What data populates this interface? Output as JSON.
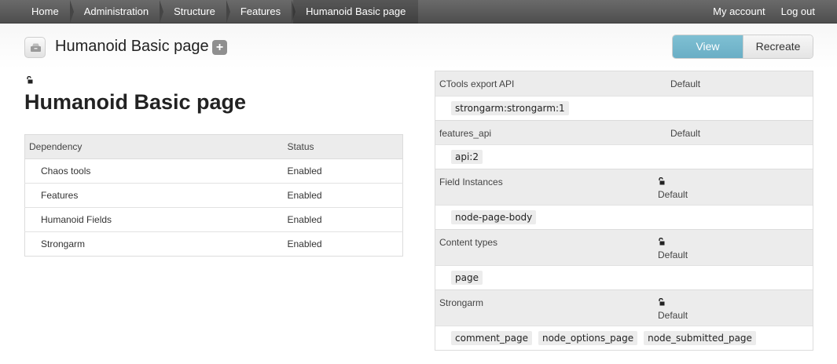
{
  "toolbar": {
    "breadcrumbs": [
      "Home",
      "Administration",
      "Structure",
      "Features",
      "Humanoid Basic page"
    ],
    "user_links": [
      "My account",
      "Log out"
    ]
  },
  "header": {
    "title": "Humanoid Basic page",
    "plus_label": "+",
    "view_label": "View",
    "recreate_label": "Recreate"
  },
  "main": {
    "heading": "Humanoid Basic page",
    "dependency_table": {
      "headers": [
        "Dependency",
        "Status"
      ],
      "rows": [
        {
          "name": "Chaos tools",
          "status": "Enabled"
        },
        {
          "name": "Features",
          "status": "Enabled"
        },
        {
          "name": "Humanoid Fields",
          "status": "Enabled"
        },
        {
          "name": "Strongarm",
          "status": "Enabled"
        }
      ]
    }
  },
  "components": [
    {
      "name": "CTools export API",
      "state": "Default",
      "items": [
        "strongarm:strongarm:1"
      ]
    },
    {
      "name": "features_api",
      "state": "Default",
      "items": [
        "api:2"
      ]
    },
    {
      "name": "Field Instances",
      "state": "Default",
      "items": [
        "node-page-body"
      ]
    },
    {
      "name": "Content types",
      "state": "Default",
      "items": [
        "page"
      ]
    },
    {
      "name": "Strongarm",
      "state": "Default",
      "items": [
        "comment_page",
        "node_options_page",
        "node_submitted_page"
      ]
    }
  ],
  "colors": {
    "toolbar_bg": "#5a5a5a",
    "view_button": "#6fb3c9",
    "status_enabled": "#1a8c7d"
  },
  "icons": [
    "feature-package-icon",
    "lock-icon",
    "plus-icon"
  ]
}
